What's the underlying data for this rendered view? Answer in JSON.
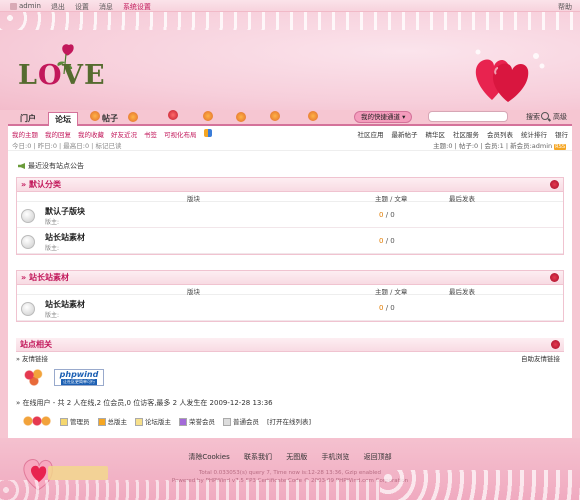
{
  "topbar": {
    "user": "admin",
    "logout": "退出",
    "settings": "设置",
    "message": "消息",
    "plugin": "系统设置",
    "right": "帮助"
  },
  "header": {
    "logo_text_l": "L",
    "logo_text_o": "O",
    "logo_text_ve": "VE"
  },
  "nav": {
    "tabs": [
      "门户",
      "论坛",
      "帖子"
    ],
    "quick_links": "我的快捷通道",
    "search_label": "搜索",
    "advanced": "高级"
  },
  "subnav": {
    "links": [
      "我的主题",
      "我的回复",
      "我的收藏",
      "好友近况",
      "书签",
      "可视化布局"
    ],
    "links2": [
      "社区应用",
      "最新帖子",
      "精华区",
      "社区服务",
      "会员列表",
      "统计排行",
      "银行"
    ],
    "stats": "今日:0 | 昨日:0 | 最高日:0 | 标记已读",
    "stats2": "主题:0 | 帖子:0 | 会员:1 | 新会员:admin",
    "rss": "RSS"
  },
  "announce": "最近没有站点公告",
  "sections": [
    {
      "title": "默认分类",
      "col_forum": "版块",
      "col_topics": "主题 / 文章",
      "col_last": "最后发表",
      "forums": [
        {
          "name": "默认子版块",
          "mod": "版主:",
          "topics": "0",
          "posts": "0"
        },
        {
          "name": "站长站素材",
          "mod": "版主:",
          "topics": "0",
          "posts": "0"
        }
      ]
    },
    {
      "title": "站长站素材",
      "col_forum": "版块",
      "col_topics": "主题 / 文章",
      "col_last": "最后发表",
      "forums": [
        {
          "name": "站长站素材",
          "mod": "版主:",
          "topics": "0",
          "posts": "0"
        }
      ]
    }
  ],
  "site": {
    "title": "站点相关",
    "links_label": "» 友情链接",
    "links_right": "自助友情链接",
    "phpwind_1": "phpwind",
    "phpwind_2": "让社区更简单可行",
    "online": "» 在线用户 - 共 2 人在线,2 位会员,0 位访客,最多 2 人发生在 2009-12-28 13:36",
    "legend": [
      "管理员",
      "总版主",
      "论坛版主",
      "荣誉会员",
      "普通会员"
    ],
    "open_list": "[打开在线列表]"
  },
  "footer": {
    "links": [
      "清除Cookies",
      "联系我们",
      "无图版",
      "手机浏览",
      "返回顶部"
    ],
    "copy1": "Total 0.033053(s) query 7, Time now is:12-28 13:36, Gzip enabled",
    "copy2": "Powered by PHPWind v7.5 SP3 Certificate Code © 2003-09 PHPWind.com Corporation"
  },
  "colors": {
    "accent": "#c2185b",
    "bg": "#f6c6d2",
    "border": "#f0c3d0"
  }
}
